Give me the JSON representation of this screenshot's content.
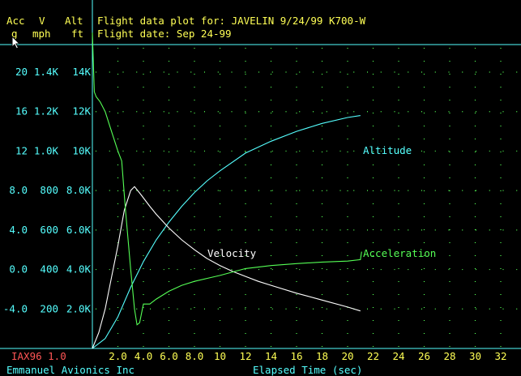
{
  "header": {
    "col_heads_top": [
      "Acc",
      "V",
      "Alt"
    ],
    "col_heads_units": [
      "g",
      "mph",
      "ft"
    ],
    "title_line1": "Flight data plot for: JAVELIN 9/24/99 K700-W",
    "title_line2": "Flight date: Sep 24-99"
  },
  "footer": {
    "program": "IAX96 1.0",
    "company": "Emmanuel Avionics Inc",
    "xlabel": "Elapsed Time (sec)"
  },
  "colors": {
    "yellow": "#ffff55",
    "cyan": "#55ffff",
    "red": "#ff5555",
    "green": "#55ff55",
    "white": "#ffffff",
    "grid": "#55ff55"
  },
  "chart_data": {
    "type": "line",
    "title": "Flight data plot for: JAVELIN 9/24/99 K700-W",
    "xlabel": "Elapsed Time (sec)",
    "xlim": [
      0,
      33
    ],
    "x_ticks": [
      "2.0",
      "4.0",
      "6.0",
      "8.0",
      "10",
      "12",
      "14",
      "16",
      "18",
      "20",
      "22",
      "24",
      "26",
      "28",
      "30",
      "32"
    ],
    "x_tick_values": [
      2,
      4,
      6,
      8,
      10,
      12,
      14,
      16,
      18,
      20,
      22,
      24,
      26,
      28,
      30,
      32
    ],
    "grid": true,
    "y_axes": {
      "acc": {
        "label": "Acc g",
        "lim": [
          -8,
          24
        ],
        "ticks": [
          "20",
          "16",
          "12",
          "8.0",
          "4.0",
          "0.0",
          "-4.0"
        ]
      },
      "vel": {
        "label": "V mph",
        "lim": [
          0,
          1600
        ],
        "ticks": [
          "1.4K",
          "1.2K",
          "1.0K",
          "800",
          "600",
          "400",
          "200"
        ]
      },
      "alt": {
        "label": "Alt ft",
        "lim": [
          0,
          16000
        ],
        "ticks": [
          "14K",
          "12K",
          "10K",
          "8.0K",
          "6.0K",
          "4.0K",
          "2.0K"
        ]
      }
    },
    "series": [
      {
        "name": "Altitude",
        "axis": "alt",
        "x": [
          0,
          1,
          2,
          3,
          4,
          5,
          6,
          7,
          8,
          9,
          10,
          12,
          14,
          16,
          18,
          20,
          21
        ],
        "y": [
          0,
          500,
          1600,
          3100,
          4400,
          5500,
          6400,
          7200,
          7900,
          8500,
          9000,
          9900,
          10500,
          11000,
          11400,
          11700,
          11800
        ]
      },
      {
        "name": "Velocity",
        "axis": "vel",
        "x": [
          0,
          0.5,
          1,
          1.5,
          2,
          2.5,
          3,
          3.3,
          3.8,
          4.5,
          5,
          6,
          7,
          8,
          9,
          10,
          11,
          12,
          13,
          14,
          16,
          18,
          20,
          21
        ],
        "y": [
          0,
          80,
          200,
          360,
          520,
          700,
          800,
          820,
          780,
          720,
          680,
          610,
          550,
          500,
          455,
          420,
          390,
          365,
          340,
          320,
          280,
          245,
          210,
          190
        ]
      },
      {
        "name": "Acceleration",
        "axis": "acc",
        "x": [
          0,
          0.15,
          0.3,
          0.6,
          1.0,
          1.5,
          2.0,
          2.3,
          2.6,
          3.0,
          3.3,
          3.5,
          3.7,
          4.0,
          4.5,
          5,
          6,
          7,
          8,
          9,
          10,
          12,
          14,
          16,
          18,
          20,
          21,
          21.1
        ],
        "y": [
          24,
          18,
          17.5,
          17,
          16,
          14,
          12,
          11,
          6,
          0,
          -4,
          -5.6,
          -5.4,
          -3.5,
          -3.5,
          -3,
          -2.2,
          -1.6,
          -1.2,
          -0.9,
          -0.6,
          0.1,
          0.4,
          0.6,
          0.75,
          0.85,
          1.0,
          1.8
        ]
      }
    ]
  }
}
